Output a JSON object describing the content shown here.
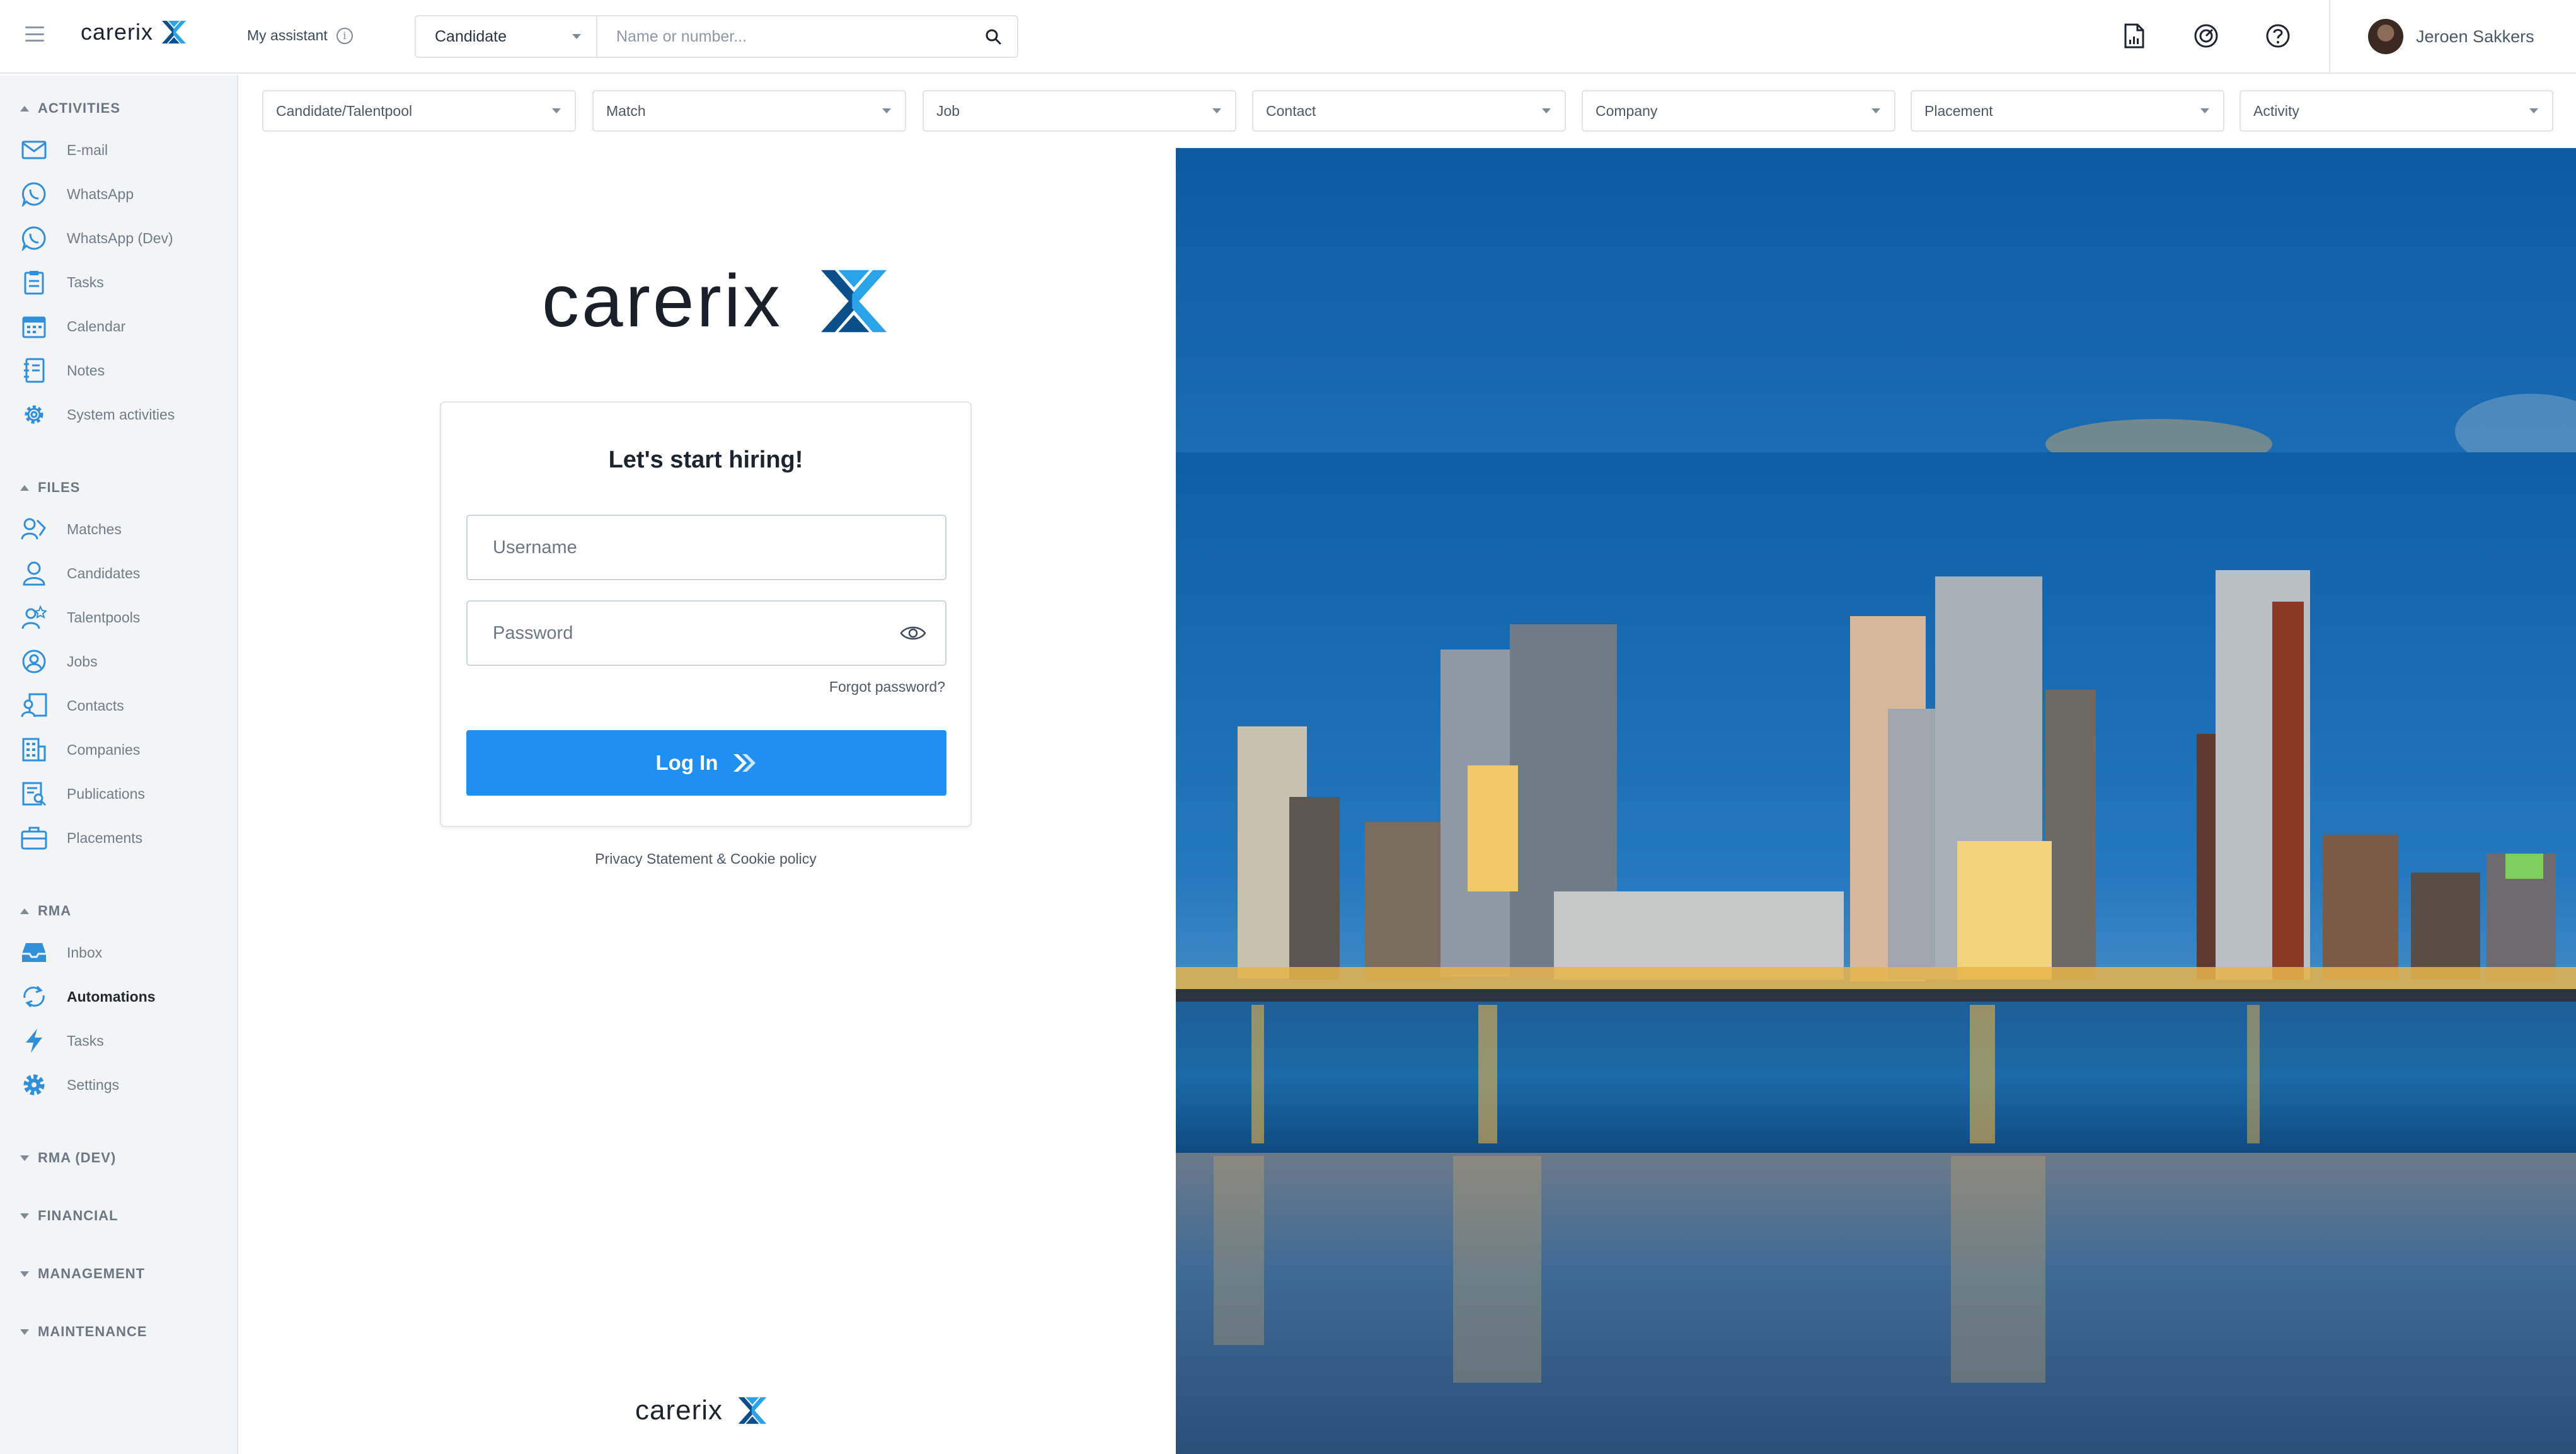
{
  "topbar": {
    "logo_text": "carerix",
    "assistant_label": "My assistant",
    "search": {
      "type_selected": "Candidate",
      "placeholder": "Name or number..."
    },
    "icons": [
      "report-icon",
      "dashboard-icon",
      "help-icon"
    ],
    "user_name": "Jeroen Sakkers"
  },
  "sidebar": {
    "activities": {
      "title": "ACTIVITIES",
      "items": [
        {
          "label": "E-mail",
          "icon": "mail-icon"
        },
        {
          "label": "WhatsApp",
          "icon": "whatsapp-icon"
        },
        {
          "label": "WhatsApp (Dev)",
          "icon": "whatsapp-icon"
        },
        {
          "label": "Tasks",
          "icon": "clipboard-icon"
        },
        {
          "label": "Calendar",
          "icon": "calendar-icon"
        },
        {
          "label": "Notes",
          "icon": "notebook-icon"
        },
        {
          "label": "System activities",
          "icon": "gear-icon"
        }
      ]
    },
    "files": {
      "title": "FILES",
      "items": [
        {
          "label": "Matches",
          "icon": "matches-icon"
        },
        {
          "label": "Candidates",
          "icon": "person-icon"
        },
        {
          "label": "Talentpools",
          "icon": "talentpool-icon"
        },
        {
          "label": "Jobs",
          "icon": "jobs-icon"
        },
        {
          "label": "Contacts",
          "icon": "contacts-icon"
        },
        {
          "label": "Companies",
          "icon": "building-icon"
        },
        {
          "label": "Publications",
          "icon": "publication-icon"
        },
        {
          "label": "Placements",
          "icon": "briefcase-icon"
        }
      ]
    },
    "rma": {
      "title": "RMA",
      "items": [
        {
          "label": "Inbox",
          "icon": "inbox-icon"
        },
        {
          "label": "Automations",
          "icon": "automation-icon",
          "active": true
        },
        {
          "label": "Tasks",
          "icon": "lightning-icon"
        },
        {
          "label": "Settings",
          "icon": "gear-icon"
        }
      ]
    },
    "collapsed": [
      "RMA (DEV)",
      "FINANCIAL",
      "MANAGEMENT",
      "MAINTENANCE"
    ]
  },
  "filters": [
    "Candidate/Talentpool",
    "Match",
    "Job",
    "Contact",
    "Company",
    "Placement",
    "Activity"
  ],
  "login": {
    "logo_text": "carerix",
    "title": "Let's start hiring!",
    "username_placeholder": "Username",
    "password_placeholder": "Password",
    "forgot": "Forgot password?",
    "button": "Log In",
    "privacy": "Privacy Statement & Cookie policy",
    "footer_logo_text": "carerix"
  },
  "colors": {
    "accent": "#1f8ff3",
    "logo_dark": "#0b4f8a",
    "logo_light": "#2aa3e8"
  }
}
